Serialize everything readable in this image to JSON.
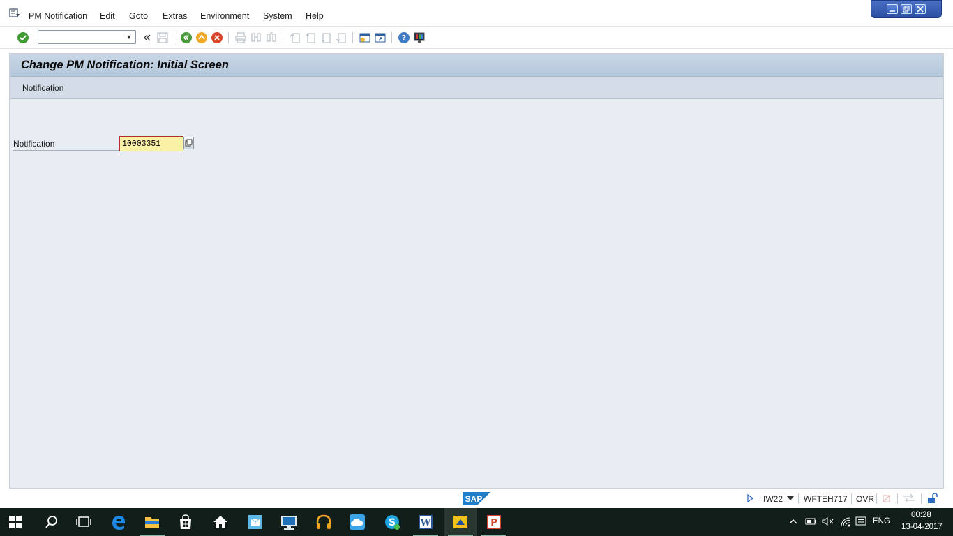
{
  "menubar": {
    "items": [
      "PM Notification",
      "Edit",
      "Goto",
      "Extras",
      "Environment",
      "System",
      "Help"
    ]
  },
  "toolbar": {
    "command_field_value": "",
    "icons": [
      "enter-icon",
      "back-nav-icon",
      "save-icon",
      "back-icon",
      "exit-icon",
      "cancel-icon",
      "print-icon",
      "find-icon",
      "find-next-icon",
      "first-page-icon",
      "previous-page-icon",
      "next-page-icon",
      "last-page-icon",
      "create-session-icon",
      "create-shortcut-icon",
      "help-icon",
      "customize-layout-icon"
    ]
  },
  "screen": {
    "title": "Change PM Notification: Initial Screen",
    "app_toolbar": {
      "notification_button": "Notification"
    },
    "form": {
      "notification_label": "Notification",
      "notification_value": "10003351"
    }
  },
  "statusbar": {
    "logo_text": "SAP",
    "transaction": "IW22",
    "server": "WFTEH717",
    "mode": "OVR"
  },
  "taskbar": {
    "language": "ENG",
    "time": "00:28",
    "date": "13-04-2017"
  },
  "colors": {
    "title_bar": "#b4c7db",
    "screen_bg": "#e8edf4",
    "input_required_bg": "#fbf1a6",
    "window_controls": "#2b4fa3",
    "taskbar": "#121e19"
  }
}
